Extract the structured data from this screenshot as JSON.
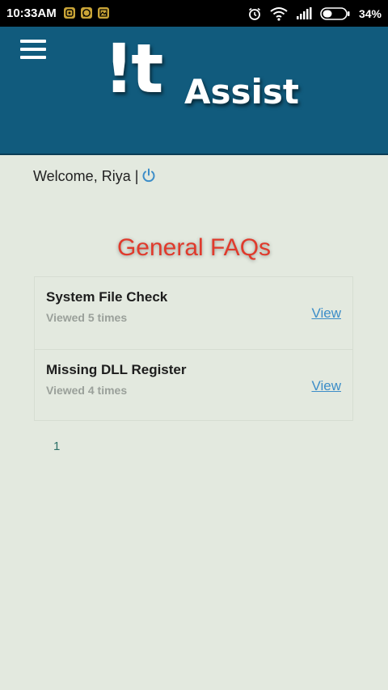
{
  "status_bar": {
    "time": "10:33AM",
    "notification_icons": [
      "photos-icon",
      "whatsapp-icon",
      "gallery-icon"
    ],
    "battery_percent": "34%"
  },
  "header": {
    "logo_mark": "!t",
    "logo_word": "Assist",
    "background_color": "#115b7d"
  },
  "user": {
    "welcome_text": "Welcome, Riya",
    "separator": "|"
  },
  "section": {
    "title": "General FAQs",
    "title_color": "#e03a2c"
  },
  "faqs": [
    {
      "title": "System File Check",
      "views": "Viewed 5 times",
      "link_label": "View"
    },
    {
      "title": "Missing DLL Register",
      "views": "Viewed 4 times",
      "link_label": "View"
    }
  ],
  "pagination": {
    "pages": [
      "1"
    ]
  }
}
